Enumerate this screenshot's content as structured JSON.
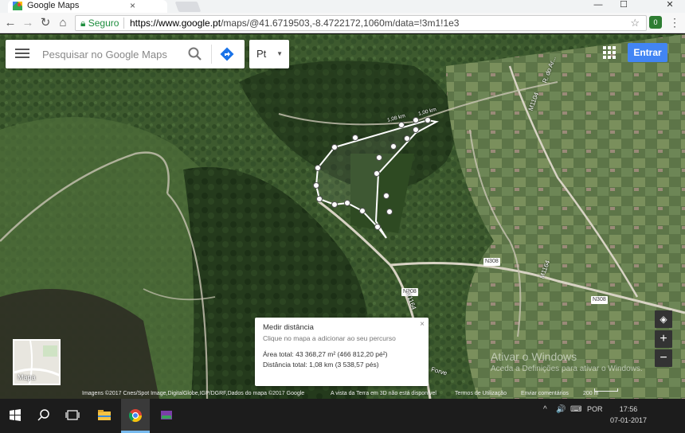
{
  "browser": {
    "tab_title": "Google Maps",
    "tab_close": "×",
    "window_controls": [
      "—",
      "☐",
      "✕"
    ],
    "back_icon": "←",
    "forward_icon": "→",
    "reload_icon": "↻",
    "home_icon": "⌂",
    "secure_label": "Seguro",
    "url_host": "https://www.google.pt",
    "url_path": "/maps/@41.6719503,-8.4722172,1060m/data=!3m1!1e3",
    "star_icon": "☆",
    "kebab_icon": "⋮",
    "extension_badge": "0"
  },
  "maps": {
    "search_placeholder": "Pesquisar no Google Maps",
    "language_value": "Pt",
    "signin_label": "Entrar",
    "thumbnail_label": "Mapa",
    "zoom_in": "+",
    "zoom_out": "−",
    "compass": "◈",
    "road_labels": [
      "N308",
      "N308",
      "N308",
      "M1164",
      "M1104",
      "M1164"
    ],
    "distance_labels": [
      "1,08 km",
      "1,00 km"
    ],
    "place_labels": [
      "R. do Ar...",
      "Forve"
    ],
    "measure": {
      "title": "Medir distância",
      "hint": "Clique no mapa a adicionar ao seu percurso",
      "area": "Área total: 43 368,27 m² (466 812,20 pé²)",
      "distance": "Distância total: 1,08 km (3 538,57 pés)",
      "close": "×"
    },
    "attribution": {
      "imagery": "Imagens ©2017 Cnes/Spot Image,DigitalGlobe,IGP/DGRF,Dados do mapa ©2017 Google",
      "earth": "A vista da Terra em 3D não está disponível",
      "terms": "Termos de Utilização",
      "feedback": "Enviar comentários",
      "scale": "200 m"
    },
    "watermark": {
      "line1": "Ativar o Windows",
      "line2": "Aceda a Definições para ativar o Windows."
    }
  },
  "taskbar": {
    "language": "POR",
    "time": "17:56",
    "date": "07-01-2017",
    "systray_icons": [
      "^",
      "🔊",
      "⌨"
    ]
  }
}
